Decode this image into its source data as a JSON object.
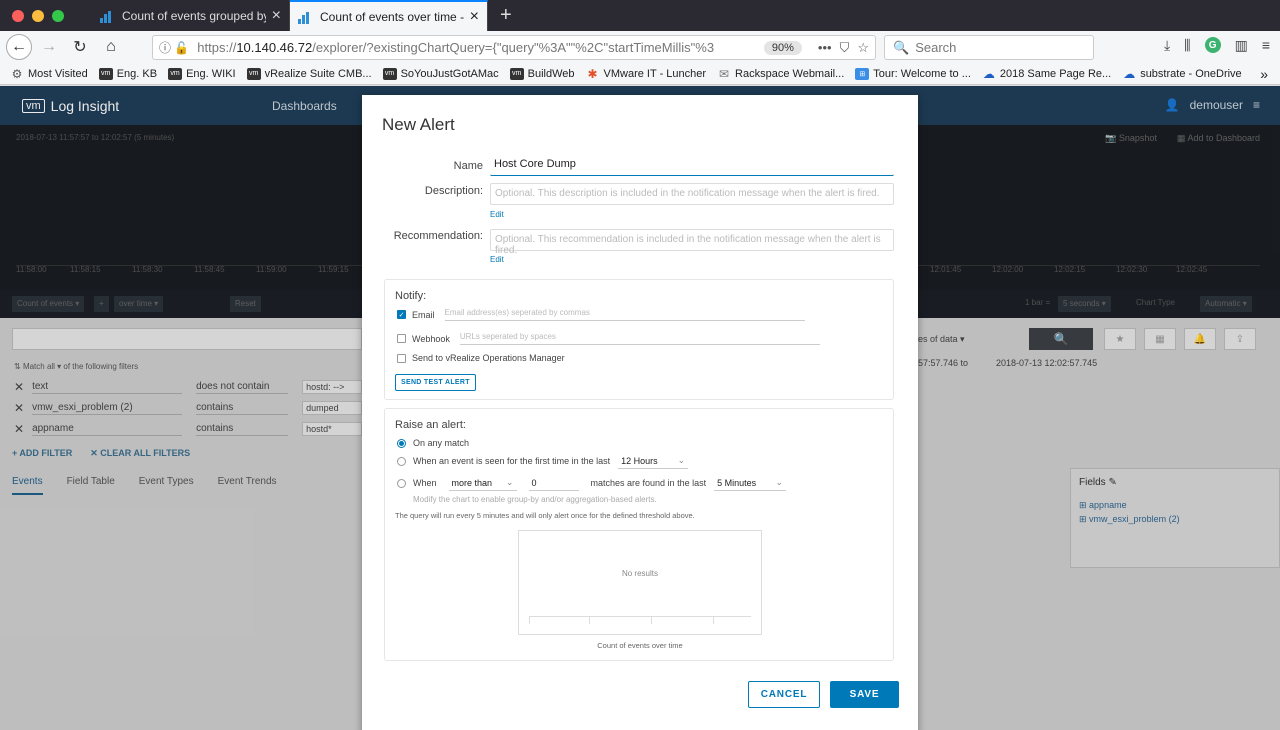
{
  "browser": {
    "tabs": [
      {
        "label": "Count of events grouped by ho",
        "active": false
      },
      {
        "label": "Count of events over time - Inte",
        "active": true
      }
    ],
    "url_prefix": "https://",
    "url_host": "10.140.46.72",
    "url_rest": "/explorer/?existingChartQuery={\"query\"%3A\"\"%2C\"startTimeMillis\"%3",
    "zoom": "90%",
    "search_placeholder": "Search",
    "bookmarks": [
      {
        "label": "Most Visited",
        "icon": "gear-icon"
      },
      {
        "label": "Eng. KB",
        "icon": "vm-icon"
      },
      {
        "label": "Eng. WIKI",
        "icon": "vm-icon"
      },
      {
        "label": "vRealize Suite CMB...",
        "icon": "vm-icon"
      },
      {
        "label": "SoYouJustGotAMac",
        "icon": "vm-icon"
      },
      {
        "label": "BuildWeb",
        "icon": "vm-icon"
      },
      {
        "label": "VMware IT - Luncher",
        "icon": "pinwheel-icon"
      },
      {
        "label": "Rackspace Webmail...",
        "icon": "envelope-icon"
      },
      {
        "label": "Tour: Welcome to ...",
        "icon": "windows-icon"
      },
      {
        "label": "2018 Same Page Re...",
        "icon": "cloud-icon"
      },
      {
        "label": "substrate - OneDrive",
        "icon": "cloud-icon"
      }
    ]
  },
  "app": {
    "logo_badge": "vm",
    "name": "Log Insight",
    "nav": [
      "Dashboards"
    ],
    "user": "demouser"
  },
  "background": {
    "time_range": "2018-07-13   11:57:57   to   12:02:57   (5 minutes)",
    "snapshot": "Snapshot",
    "add_dashboard": "Add to Dashboard",
    "ticks_left": [
      "11:58:00",
      "11:58:15",
      "11:58:30",
      "11:58:45",
      "11:59:00",
      "11:59:15"
    ],
    "ticks_right": [
      "12:01:45",
      "12:02:00",
      "12:02:15",
      "12:02:30",
      "12:02:45"
    ],
    "count_btn": "Count of events",
    "over_time_btn": "over time",
    "reset_btn": "Reset",
    "bar_label": "1 bar =",
    "bar_value": "5 seconds",
    "chart_type_label": "Chart Type",
    "chart_type_value": "Automatic",
    "match_text": "Match all ▾ of the following filters",
    "filters": [
      {
        "field": "text",
        "op": "does not contain",
        "value": "hostd: -->"
      },
      {
        "field": "vmw_esxi_problem (2)",
        "op": "contains",
        "value": "dumped"
      },
      {
        "field": "appname",
        "op": "contains",
        "value": "hostd*"
      }
    ],
    "add_filter": "+ ADD FILTER",
    "clear_filters": "✕ CLEAR ALL FILTERS",
    "event_tabs": [
      "Events",
      "Field Table",
      "Event Types",
      "Event Trends"
    ],
    "range_from": "57:57.746   to",
    "range_to": "2018-07-13 12:02:57.745",
    "data_select": "es of data",
    "fields_title": "Fields",
    "fields": [
      "appname",
      "vmw_esxi_problem (2)"
    ]
  },
  "modal": {
    "title": "New Alert",
    "name_label": "Name",
    "name_value": "Host Core Dump",
    "description_label": "Description:",
    "description_placeholder": "Optional. This description is included in the notification message when the alert is fired.",
    "recommendation_label": "Recommendation:",
    "recommendation_placeholder": "Optional. This recommendation is included in the notification message when the alert is fired.",
    "edit_label": "Edit",
    "notify": {
      "title": "Notify:",
      "email_label": "Email",
      "email_checked": true,
      "email_placeholder": "Email address(es) seperated by commas",
      "webhook_label": "Webhook",
      "webhook_checked": false,
      "webhook_placeholder": "URLs seperated by spaces",
      "vrops_label": "Send to vRealize Operations Manager",
      "vrops_checked": false,
      "test_button": "SEND TEST ALERT"
    },
    "raise": {
      "title": "Raise an alert:",
      "opt_any": "On any match",
      "opt_first_time": "When an event is seen for the first time in the last",
      "first_time_window": "12 Hours",
      "opt_when": "When",
      "comparator": "more than",
      "threshold": "0",
      "matches_text": "matches are found in the last",
      "threshold_window": "5 Minutes",
      "hint": "Modify the chart to enable group-by and/or aggregation-based alerts.",
      "query_note": "The query will run every 5 minutes and will only alert once for the defined threshold above.",
      "preview_empty": "No results",
      "preview_caption": "Count of events over time"
    },
    "cancel": "CANCEL",
    "save": "SAVE"
  }
}
